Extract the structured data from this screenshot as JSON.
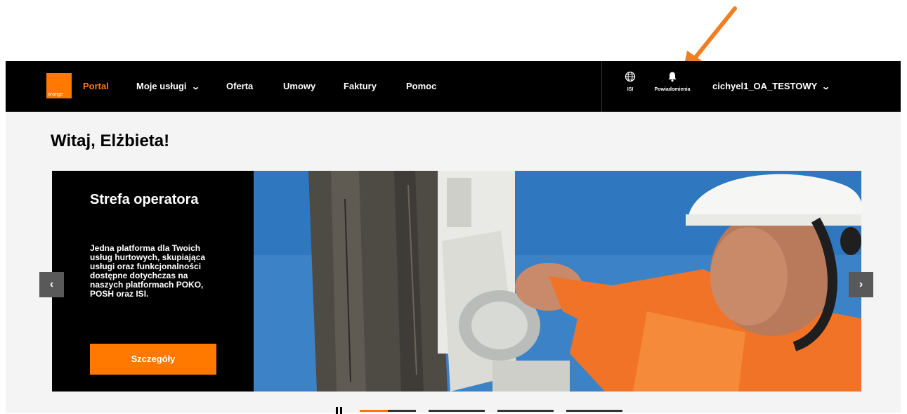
{
  "header": {
    "logo_text": "orange",
    "nav": [
      {
        "label": "Portal",
        "active": true
      },
      {
        "label": "Moje usługi",
        "has_dropdown": true
      },
      {
        "label": "Oferta"
      },
      {
        "label": "Umowy"
      },
      {
        "label": "Faktury"
      },
      {
        "label": "Pomoc"
      }
    ],
    "isi_label": "ISI",
    "notifications_label": "Powiadomienia",
    "user_label": "cichyel1_OA_TESTOWY"
  },
  "greeting": "Witaj, Elżbieta!",
  "hero": {
    "title": "Strefa operatora",
    "description": "Jedna platforma dla Twoich usług hurtowych, skupiająca usługi oraz funkcjonalności dostępne dotychczas na naszych platformach POKO, POSH oraz ISI.",
    "cta_label": "Szczegóły"
  },
  "carousel": {
    "prev_icon": "chevron-left-icon",
    "next_icon": "chevron-right-icon",
    "prev_glyph": "‹",
    "next_glyph": "›",
    "slides_count": 4,
    "active_index": 0
  },
  "colors": {
    "brand": "#ff7900",
    "nav_bg": "#000000",
    "page_bg": "#f4f4f4"
  }
}
